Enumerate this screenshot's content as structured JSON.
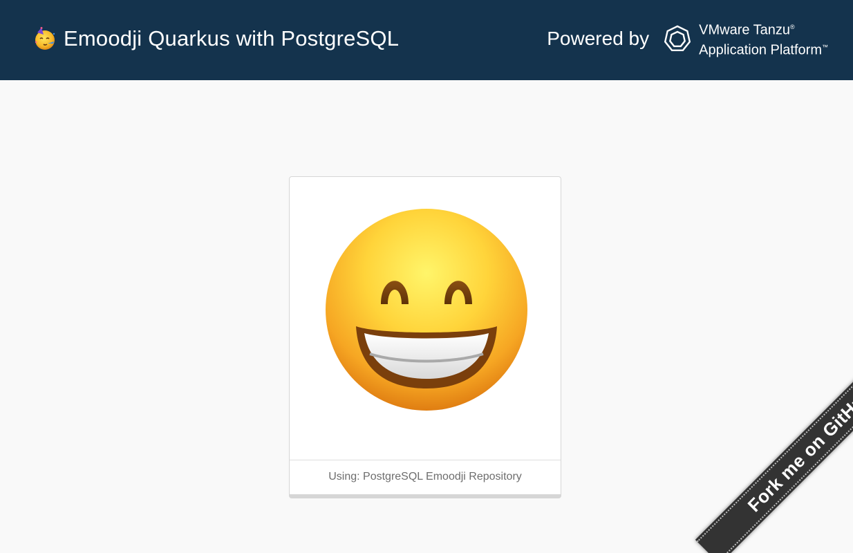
{
  "header": {
    "title": "Emoodji Quarkus with PostgreSQL",
    "title_icon": "partying-face-icon",
    "powered_by": "Powered by",
    "platform_line1": "VMware Tanzu",
    "platform_line2": "Application Platform",
    "platform_line1_mark": "®",
    "platform_line2_mark": "™",
    "platform_icon": "tanzu-logo-icon",
    "background_color": "#14334d"
  },
  "card": {
    "emoji_icon": "grinning-face-with-smiling-eyes-icon",
    "footer_text": "Using: PostgreSQL Emoodji Repository"
  },
  "ribbon": {
    "label": "Fork me on GitHub"
  }
}
